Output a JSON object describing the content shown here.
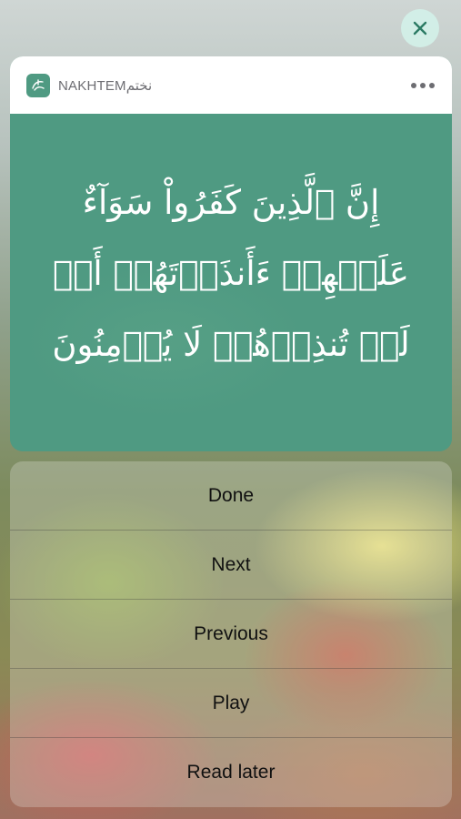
{
  "close_button": {
    "icon": "close-icon"
  },
  "notification": {
    "app_name": "NAKHTEMنختم",
    "app_icon": "nakhtem-logo-icon",
    "more_icon": "ellipsis-icon",
    "verse": "إِنَّ ٱلَّذِينَ كَفَرُواْ سَوَآءٌ عَلَيۡهِمۡ ءَأَنذَرۡتَهُمۡ أَمۡ لَمۡ تُنذِرۡهُمۡ لَا يُؤۡمِنُونَ"
  },
  "actions": [
    {
      "label": "Done"
    },
    {
      "label": "Next"
    },
    {
      "label": "Previous"
    },
    {
      "label": "Play"
    },
    {
      "label": "Read later"
    }
  ],
  "colors": {
    "accent": "#4f9a82",
    "header_bg": "#ffffff",
    "close_bg": "#d2f0e8"
  }
}
